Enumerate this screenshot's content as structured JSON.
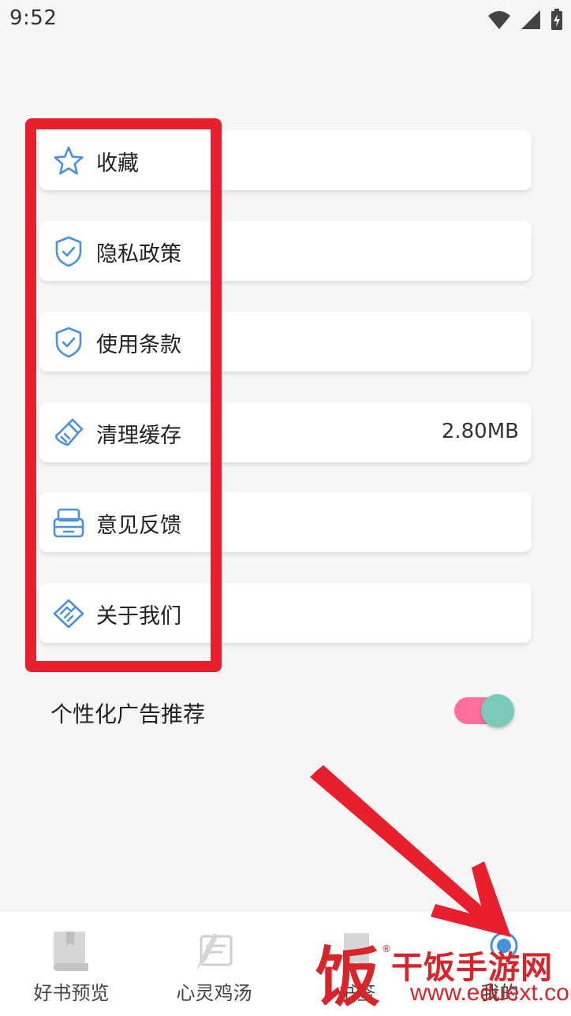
{
  "status_bar": {
    "time": "9:52"
  },
  "menu": {
    "items": [
      {
        "label": "收藏",
        "icon": "star-icon",
        "value": ""
      },
      {
        "label": "隐私政策",
        "icon": "shield-check-icon",
        "value": ""
      },
      {
        "label": "使用条款",
        "icon": "shield-check-icon",
        "value": ""
      },
      {
        "label": "清理缓存",
        "icon": "broom-icon",
        "value": "2.80MB"
      },
      {
        "label": "意见反馈",
        "icon": "feedback-tray-icon",
        "value": ""
      },
      {
        "label": "关于我们",
        "icon": "handshake-icon",
        "value": ""
      }
    ]
  },
  "settings": {
    "personalized_ads_label": "个性化广告推荐",
    "personalized_ads_enabled": true
  },
  "tab_bar": {
    "tabs": [
      {
        "label": "好书预览",
        "icon": "book-icon",
        "active": false
      },
      {
        "label": "心灵鸡汤",
        "icon": "notepad-pen-icon",
        "active": false
      },
      {
        "label": "书签",
        "icon": "bookmark-icon",
        "active": false
      },
      {
        "label": "我的",
        "icon": "user-icon",
        "active": true
      }
    ]
  },
  "watermark": {
    "logo_char": "饭",
    "registered": "®",
    "title": "干饭手游网",
    "url": "www.eduext.com"
  },
  "colors": {
    "background": "#f6f6f6",
    "icon_blue": "#4a90e2",
    "annotation_red": "#e8202e",
    "toggle_track": "#ff6f9c",
    "toggle_knob": "#7bc9b8"
  }
}
